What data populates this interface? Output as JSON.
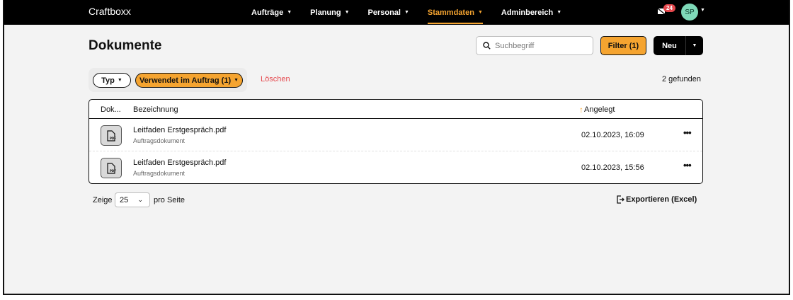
{
  "app": {
    "brand": "Craftboxx"
  },
  "nav": {
    "items": [
      {
        "label": "Aufträge"
      },
      {
        "label": "Planung"
      },
      {
        "label": "Personal"
      },
      {
        "label": "Stammdaten"
      },
      {
        "label": "Adminbereich"
      }
    ],
    "active": "Stammdaten",
    "notification_count": "24",
    "avatar_initials": "SP"
  },
  "page": {
    "title": "Dokumente",
    "search_placeholder": "Suchbegriff",
    "filter_button": "Filter (1)",
    "new_button": "Neu"
  },
  "filters": {
    "type_chip": "Typ",
    "used_chip": "Verwendet im Auftrag (1)",
    "delete_label": "Löschen",
    "found_text": "2 gefunden"
  },
  "table": {
    "columns": {
      "doc": "Dok...",
      "name": "Bezeichnung",
      "created": "Angelegt"
    },
    "rows": [
      {
        "icon": "pdf-file-icon",
        "name": "Leitfaden Erstgespräch.pdf",
        "subtitle": "Auftragsdokument",
        "created": "02.10.2023, 16:09"
      },
      {
        "icon": "pdf-file-icon",
        "name": "Leitfaden Erstgespräch.pdf",
        "subtitle": "Auftragsdokument",
        "created": "02.10.2023, 15:56"
      }
    ]
  },
  "footer": {
    "show_label": "Zeige",
    "per_page_value": "25",
    "per_page_label": "pro Seite",
    "export_label": "Exportieren (Excel)"
  },
  "colors": {
    "accent": "#f5a430",
    "danger": "#e5484d",
    "avatar": "#7ed9b8"
  }
}
